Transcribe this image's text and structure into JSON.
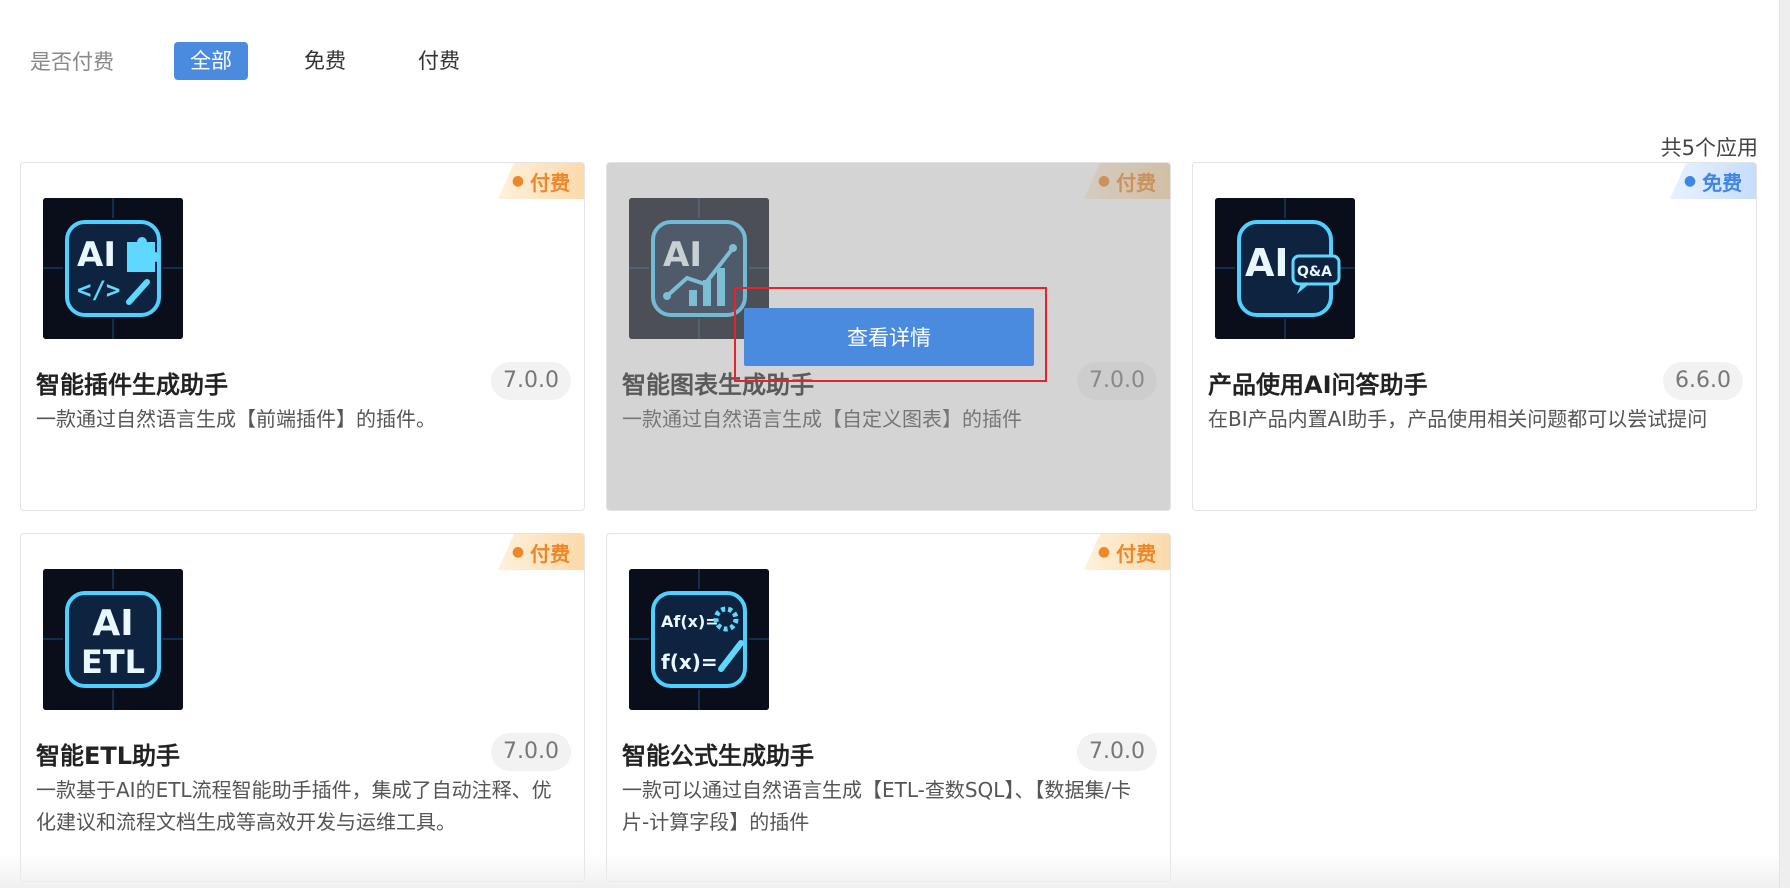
{
  "filter": {
    "label": "是否付费",
    "options": [
      "全部",
      "免费",
      "付费"
    ],
    "selected": "全部"
  },
  "total_count": "共5个应用",
  "cards": [
    {
      "name": "智能插件生成助手",
      "version": "7.0.0",
      "badge": "付费",
      "description": "一款通过自然语言生成【前端插件】的插件。",
      "icon": "ai-plugin-icon",
      "icon_text": "AI"
    },
    {
      "name": "智能图表生成助手",
      "version": "7.0.0",
      "badge": "付费",
      "description": "一款通过自然语言生成【自定义图表】的插件",
      "icon": "ai-chart-icon",
      "icon_text": "AI",
      "hover_button": "查看详情"
    },
    {
      "name": "产品使用AI问答助手",
      "version": "6.6.0",
      "badge": "免费",
      "description": "在BI产品内置AI助手，产品使用相关问题都可以尝试提问",
      "icon": "ai-qa-icon",
      "icon_text": "AI",
      "icon_subtext": "Q&A"
    },
    {
      "name": "智能ETL助手",
      "version": "7.0.0",
      "badge": "付费",
      "description": "一款基于AI的ETL流程智能助手插件，集成了自动注释、优化建议和流程文档生成等高效开发与运维工具。",
      "icon": "ai-etl-icon",
      "icon_text": "AI",
      "icon_subtext": "ETL"
    },
    {
      "name": "智能公式生成助手",
      "version": "7.0.0",
      "badge": "付费",
      "description": "一款可以通过自然语言生成【ETL-查数SQL】、【数据集/卡片-计算字段】的插件",
      "icon": "formula-icon",
      "icon_text": "Af(x)=",
      "icon_subtext": "f(x)="
    }
  ],
  "colors": {
    "accent": "#4a8bdf",
    "paid_badge": "#ee8727",
    "free_badge": "#3f86e5",
    "focus_box": "#e3242b"
  }
}
